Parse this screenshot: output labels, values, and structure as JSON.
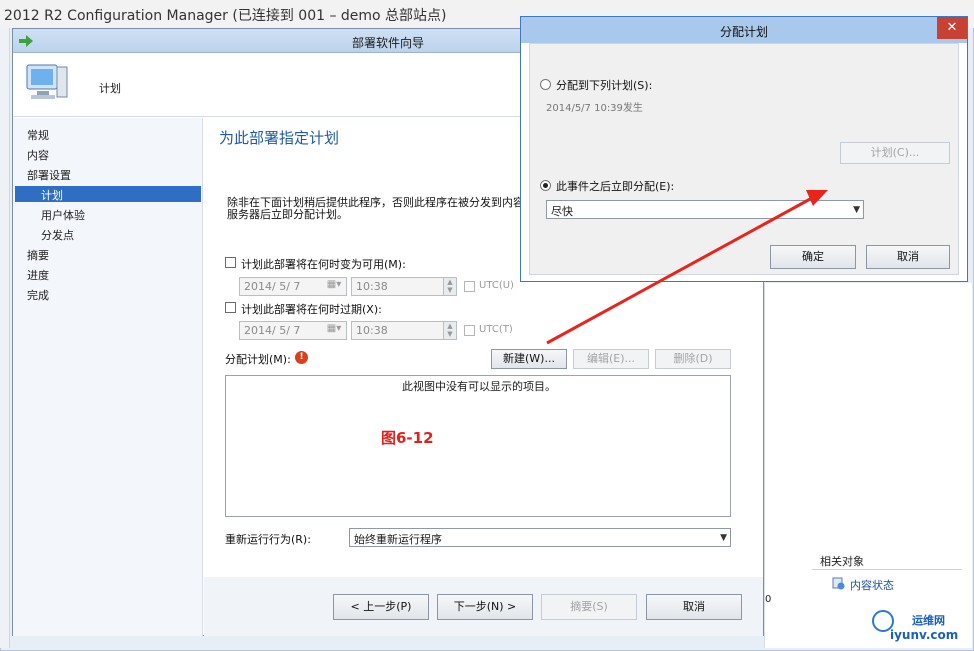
{
  "main_window": {
    "title": "2012 R2 Configuration Manager (已连接到 001 – demo 总部站点)",
    "related_objects_label": "相关对象",
    "content_status_link": "内容状态",
    "behind_digit": "0"
  },
  "wizard": {
    "title": "部署软件向导",
    "header_label": "计划",
    "nav_items": [
      "常规",
      "内容",
      "部署设置",
      "计划",
      "用户体验",
      "分发点",
      "摘要",
      "进度",
      "完成"
    ],
    "selected_nav": "计划",
    "page_heading": "为此部署指定计划",
    "description": "除非在下面计划稍后提供此程序，否则此程序在被分发到内容服务器后立即分配计划。",
    "available_check_label": "计划此部署将在何时变为可用(M):",
    "available_date": "2014/ 5/ 7",
    "available_time": "10:38",
    "utc_label_1": "UTC(U)",
    "expire_check_label": "计划此部署将在何时过期(X):",
    "expire_date": "2014/ 5/ 7",
    "expire_time": "10:38",
    "utc_label_2": "UTC(T)",
    "assignment_schedule_label": "分配计划(M):",
    "warn_glyph": "!",
    "new_button": "新建(W)...",
    "edit_button": "编辑(E)...",
    "delete_button": "删除(D)",
    "empty_list_message": "此视图中没有可以显示的项目。",
    "figure_caption": "图6-12",
    "rerun_label": "重新运行行为(R):",
    "rerun_value": "始终重新运行程序",
    "prev_button": "< 上一步(P)",
    "next_button": "下一步(N) >",
    "summary_button": "摘要(S)",
    "cancel_button": "取消"
  },
  "assign_dialog": {
    "title": "分配计划",
    "close_glyph": "✕",
    "option_schedule_label": "分配到下列计划(S):",
    "schedule_text": "2014/5/7 10:39发生",
    "schedule_button": "计划(C)...",
    "option_event_label": "此事件之后立即分配(E):",
    "event_value": "尽快",
    "ok_button": "确定",
    "cancel_button": "取消",
    "selected_option": "event"
  },
  "watermark": {
    "text": "运维网",
    "url": "iyunv.com"
  },
  "colors": {
    "annotation_arrow": "#e8241c",
    "accent": "#2e6fc4",
    "heading": "#1f5aa6"
  }
}
